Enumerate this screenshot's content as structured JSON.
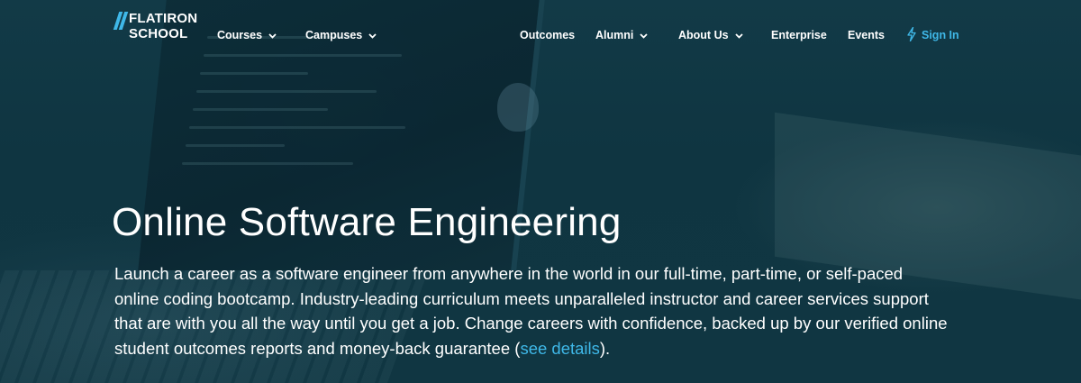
{
  "brand": {
    "line1": "Flatiron",
    "line2": "School",
    "accent_color": "#3fb8e8",
    "icon": "double-slash-logo-icon"
  },
  "nav": {
    "courses": "Courses",
    "campuses": "Campuses",
    "outcomes": "Outcomes",
    "alumni": "Alumni",
    "about_us": "About Us",
    "enterprise": "Enterprise",
    "events": "Events",
    "sign_in": "Sign In",
    "dropdown_icon": "chevron-down-icon",
    "sign_in_icon": "lightning-bolt-icon"
  },
  "hero": {
    "title": "Online Software Engineering",
    "lines": [
      "Launch a career as a software engineer from anywhere in the world in our full-time, part-time, or self-paced",
      "online coding bootcamp. Industry-leading curriculum meets unparalleled instructor and career services support",
      "that are with you all the way until you get a job. Change careers with confidence, backed up by our verified online"
    ],
    "last_line_before": "student outcomes reports and money-back guarantee (",
    "link_text": "see details",
    "last_line_after": ")."
  },
  "colors": {
    "background": "#0f3440",
    "text": "#ffffff",
    "link": "#3fb8e8"
  }
}
